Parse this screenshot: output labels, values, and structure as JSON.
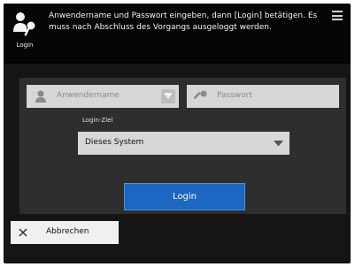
{
  "header": {
    "login_caption": "Login",
    "message": "Anwendername und Passwort eingeben, dann [Login] betätigen. Es muss nach Abschluss des Vorgangs ausgeloggt werden.",
    "icons": {
      "login": "login-key-person-icon",
      "menu": "menu-icon"
    }
  },
  "form": {
    "username_placeholder": "Anwendername",
    "password_placeholder": "Passwort",
    "destination_label": "Login-Ziel",
    "destination_value": "Dieses System",
    "login_label": "Login"
  },
  "footer": {
    "cancel_label": "Abbrechen"
  },
  "colors": {
    "login_button": "#1d66c2",
    "header_bg": "#050505",
    "panel_bg": "#2e2e2e",
    "field_bg": "#d7d7d7"
  }
}
